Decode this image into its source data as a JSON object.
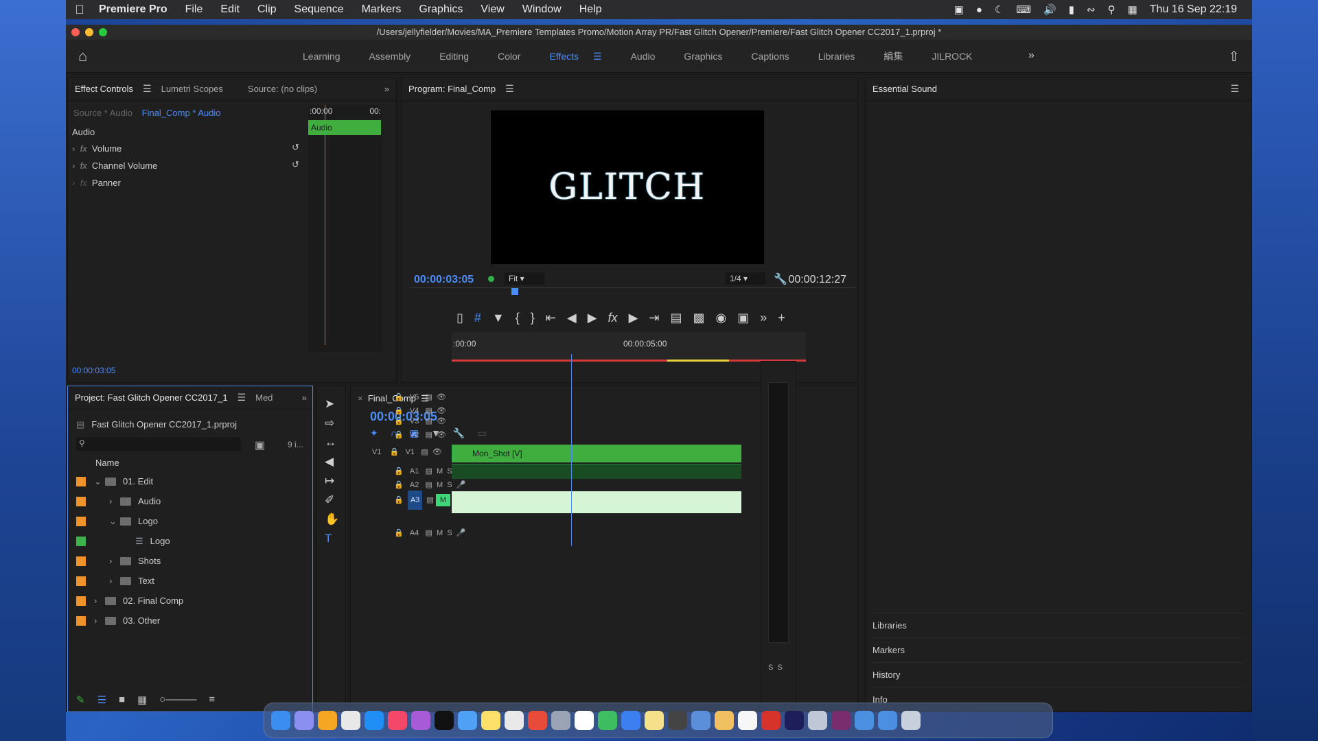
{
  "menubar": {
    "app_name": "Premiere Pro",
    "menus": [
      "File",
      "Edit",
      "Clip",
      "Sequence",
      "Markers",
      "Graphics",
      "View",
      "Window",
      "Help"
    ],
    "clock": "Thu 16 Sep  22:19"
  },
  "window": {
    "title": "/Users/jellyfielder/Movies/MA_Premiere Templates Promo/Motion Array PR/Fast Glitch Opener/Premiere/Fast Glitch Opener CC2017_1.prproj *"
  },
  "workspaces": {
    "tabs": [
      "Learning",
      "Assembly",
      "Editing",
      "Color",
      "Effects",
      "Audio",
      "Graphics",
      "Captions",
      "Libraries",
      "編集",
      "JILROCK"
    ],
    "active": "Effects"
  },
  "effect_controls": {
    "tabs": [
      "Effect Controls",
      "Lumetri Scopes",
      "Source: (no clips)"
    ],
    "source_label": "Source * Audio",
    "sequence_label": "Final_Comp * Audio",
    "section": "Audio",
    "ruler_start": ":00:00",
    "ruler_end": "00:",
    "effects": [
      "Volume",
      "Channel Volume",
      "Panner"
    ],
    "clip_label": "Audio",
    "time": "00:00:03:05"
  },
  "program": {
    "title": "Program: Final_Comp",
    "video_text": "GLITCH",
    "current_time": "00:00:03:05",
    "fit": "Fit",
    "zoom": "1/4",
    "duration": "00:00:12:27"
  },
  "essential_sound": {
    "title": "Essential Sound",
    "links": [
      "Libraries",
      "Markers",
      "History",
      "Info"
    ]
  },
  "project": {
    "tabs": [
      "Project: Fast Glitch Opener CC2017_1",
      "Med"
    ],
    "file": "Fast Glitch Opener CC2017_1.prproj",
    "item_count": "9 i...",
    "name_header": "Name",
    "items": [
      {
        "name": "01. Edit",
        "color": "#f0932b",
        "indent": 0,
        "open": true
      },
      {
        "name": "Audio",
        "color": "#f0932b",
        "indent": 1,
        "open": false
      },
      {
        "name": "Logo",
        "color": "#f0932b",
        "indent": 1,
        "open": true
      },
      {
        "name": "Logo",
        "color": "#3cb44b",
        "indent": 2,
        "open": null
      },
      {
        "name": "Shots",
        "color": "#f0932b",
        "indent": 1,
        "open": false
      },
      {
        "name": "Text",
        "color": "#f0932b",
        "indent": 1,
        "open": false
      },
      {
        "name": "02. Final Comp",
        "color": "#f0932b",
        "indent": 0,
        "open": false
      },
      {
        "name": "03. Other",
        "color": "#f0932b",
        "indent": 0,
        "open": false
      }
    ]
  },
  "timeline": {
    "sequence": "Final_Comp",
    "time": "00:00:03:05",
    "ruler_start": ":00:00",
    "ruler_mark": "00:00:05:00",
    "video_tracks": [
      "V5",
      "V4",
      "V3",
      "V2",
      "V1"
    ],
    "audio_tracks": [
      "A1",
      "A2",
      "A3",
      "A4"
    ],
    "v1_clip": "Mon_Shot [V]",
    "mute_label": "M",
    "solo_label": "S"
  },
  "meter": {
    "solo_labels": [
      "S",
      "S"
    ]
  },
  "colors": {
    "accent_blue": "#4b8cf7",
    "clip_green": "#3fae3f",
    "label_orange": "#f0932b"
  }
}
